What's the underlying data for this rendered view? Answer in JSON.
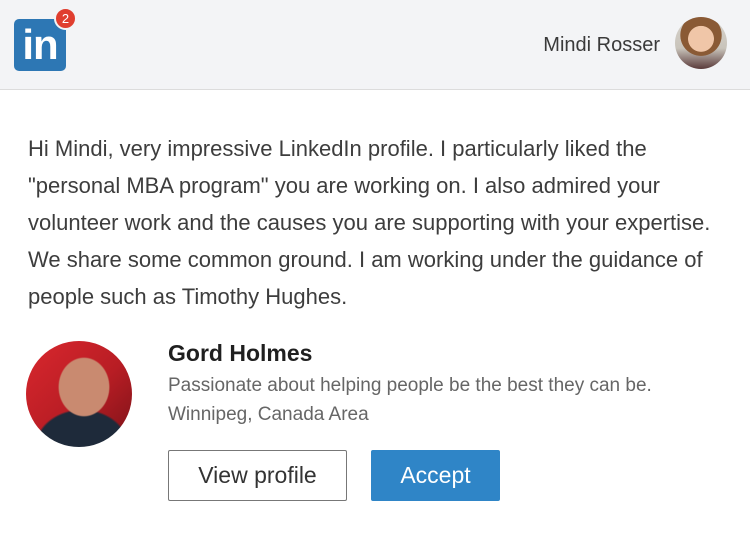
{
  "header": {
    "logo_text": "in",
    "notification_count": "2",
    "user_name": "Mindi Rosser"
  },
  "message": {
    "text": "Hi Mindi, very impressive LinkedIn profile. I particularly liked the \"personal MBA program\" you are working on. I also admired your volunteer work and the causes you are supporting with your expertise. We share some common ground. I am working under the guidance of people such as Timothy Hughes."
  },
  "sender": {
    "name": "Gord Holmes",
    "headline": "Passionate about helping people be the best they can be.",
    "location": "Winnipeg, Canada Area"
  },
  "actions": {
    "view_profile_label": "View profile",
    "accept_label": "Accept"
  },
  "colors": {
    "brand": "#2d77b4",
    "badge": "#e03e2f",
    "accept": "#2f85c7"
  }
}
